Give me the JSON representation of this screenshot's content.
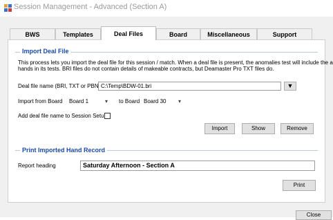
{
  "window": {
    "title": "Session Management - Advanced (Section A)"
  },
  "tabs": [
    {
      "label": "BWS Functions",
      "active": false
    },
    {
      "label": "Templates",
      "active": false
    },
    {
      "label": "Deal Files",
      "active": true
    },
    {
      "label": "Board Mapping",
      "active": false
    },
    {
      "label": "Miscellaneous",
      "active": false
    },
    {
      "label": "Support",
      "active": false
    }
  ],
  "import_group": {
    "title": "Import Deal File",
    "description_line1": "This process lets you import the deal file for this session / match. When a deal file is present, the anomalies test will include the actual",
    "description_line2": "hands in its tests. BRI files do not contain  details of makeable contracts, but Deamaster Pro TXT files do.",
    "deal_file_label": "Deal file name (BRI, TXT or PBN)",
    "deal_file_value": "C:\\Temp\\BDW-01.bri",
    "browse_glyph": "▼",
    "import_from_label": "Import from Board",
    "from_board": "Board 1",
    "to_board_label": "to Board",
    "to_board": "Board 30",
    "dropdown_glyph": "▾",
    "add_name_label": "Add deal file name to Session Setup",
    "add_name_checked": false,
    "import_button": "Import",
    "show_button": "Show",
    "remove_button": "Remove"
  },
  "print_group": {
    "title": "Print Imported Hand Record",
    "report_heading_label": "Report heading",
    "report_heading_value": "Saturday Afternoon - Section A",
    "print_button": "Print"
  },
  "footer": {
    "close_button": "Close"
  },
  "colors": {
    "group_title": "#1a4aa8",
    "dialog_bg": "#f0f0f0"
  }
}
